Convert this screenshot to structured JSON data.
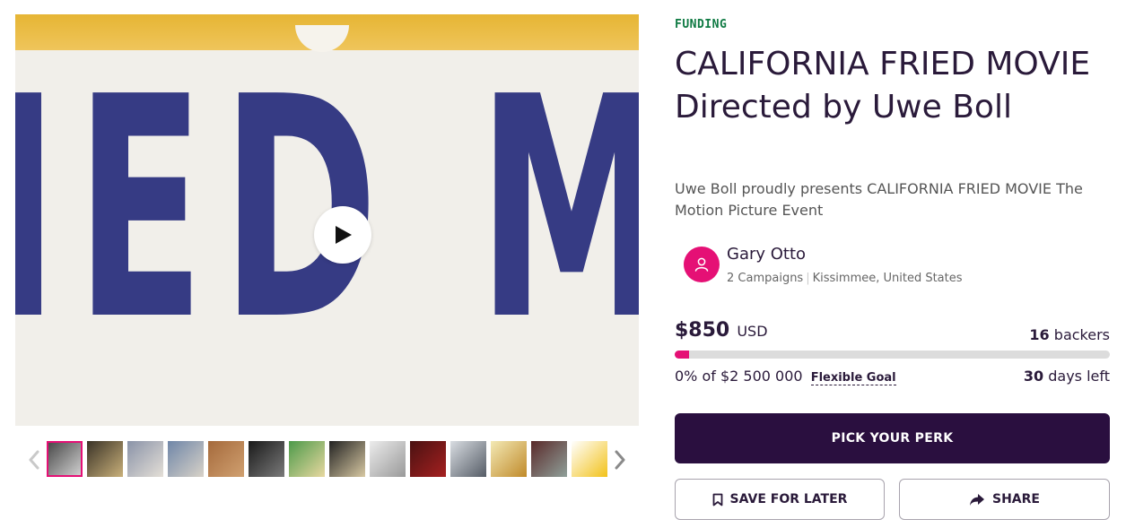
{
  "media": {
    "hero_text": "IED MOV",
    "play_icon": "play-icon",
    "prev_icon": "chevron-left-icon",
    "next_icon": "chevron-right-icon",
    "thumbnails": [
      {
        "colors": [
          "#4a4a4a",
          "#cfcfcf"
        ],
        "active": true
      },
      {
        "colors": [
          "#3a3327",
          "#c9b07a"
        ]
      },
      {
        "colors": [
          "#8a93a8",
          "#e4dfd7"
        ]
      },
      {
        "colors": [
          "#6f86a8",
          "#d8d2c8"
        ]
      },
      {
        "colors": [
          "#a56a3c",
          "#d0a070"
        ]
      },
      {
        "colors": [
          "#1a1a1a",
          "#7a7a7a"
        ]
      },
      {
        "colors": [
          "#4d9a4a",
          "#e8d8a0"
        ]
      },
      {
        "colors": [
          "#222222",
          "#d8c9a3"
        ]
      },
      {
        "colors": [
          "#ececec",
          "#999999"
        ]
      },
      {
        "colors": [
          "#4a1212",
          "#a52020"
        ]
      },
      {
        "colors": [
          "#d9dde2",
          "#555c66"
        ]
      },
      {
        "colors": [
          "#f3e9b5",
          "#c08a2a"
        ]
      },
      {
        "colors": [
          "#5a2a2a",
          "#8fa09a"
        ]
      },
      {
        "colors": [
          "#ffffff",
          "#f2c21a"
        ]
      }
    ]
  },
  "campaign": {
    "status": "FUNDING",
    "title": "CALIFORNIA FRIED MOVIE Directed by Uwe Boll",
    "tagline": "Uwe Boll proudly presents CALIFORNIA FRIED MOVIE The Motion Picture Event"
  },
  "owner": {
    "avatar_icon": "user-icon",
    "name": "Gary Otto",
    "campaigns": "2 Campaigns",
    "location": "Kissimmee, United States"
  },
  "funding": {
    "amount": "$850",
    "currency": "USD",
    "backers_count": "16",
    "backers_label": "backers",
    "percent_funded": 0.034,
    "goal_text": "0% of $2 500 000",
    "goal_type": "Flexible Goal",
    "days_count": "30",
    "days_label": "days left"
  },
  "actions": {
    "perk_label": "PICK YOUR PERK",
    "save_label": "SAVE FOR LATER",
    "save_icon": "bookmark-icon",
    "share_label": "SHARE",
    "share_icon": "share-arrow-icon"
  },
  "colors": {
    "accent": "#e51075",
    "brand_dark": "#2a0f3f",
    "status_green": "#0f7a43"
  }
}
